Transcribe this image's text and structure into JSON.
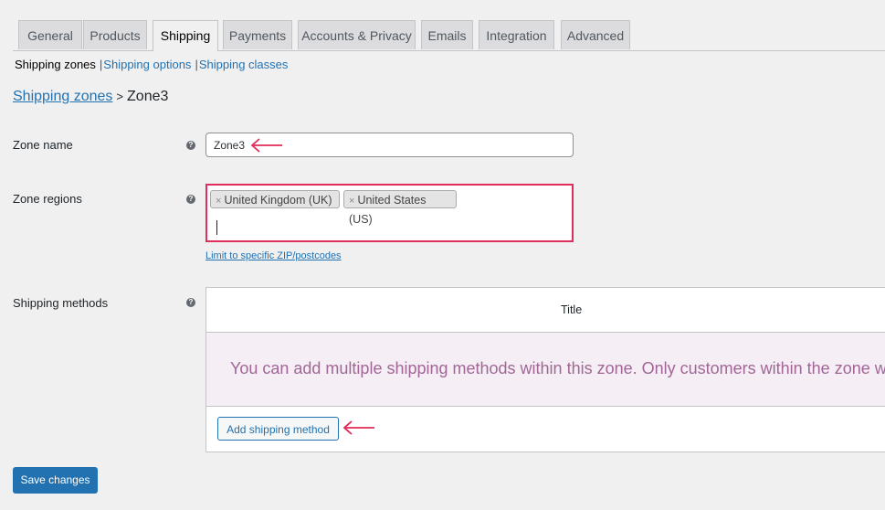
{
  "tabs": [
    {
      "label": "General",
      "active": false
    },
    {
      "label": "Products",
      "active": false
    },
    {
      "label": "Shipping",
      "active": true
    },
    {
      "label": "Payments",
      "active": false
    },
    {
      "label": "Accounts & Privacy",
      "active": false
    },
    {
      "label": "Emails",
      "active": false
    },
    {
      "label": "Integration",
      "active": false
    },
    {
      "label": "Advanced",
      "active": false
    }
  ],
  "subnav": {
    "current": "Shipping zones",
    "separator": "|",
    "links": [
      "Shipping options",
      "Shipping classes"
    ]
  },
  "breadcrumb": {
    "link": "Shipping zones",
    "separator": ">",
    "current": "Zone3"
  },
  "form": {
    "zone_name": {
      "label": "Zone name",
      "help": "?",
      "value": "Zone3"
    },
    "zone_regions": {
      "label": "Zone regions",
      "help": "?",
      "chips": [
        {
          "remove": "×",
          "label": "United Kingdom (UK)"
        },
        {
          "remove": "×",
          "label": "United States (US)"
        }
      ],
      "limit_link": "Limit to specific ZIP/postcodes"
    },
    "shipping_methods": {
      "label": "Shipping methods",
      "help": "?",
      "column_title": "Title",
      "empty_message": "You can add multiple shipping methods within this zone. Only customers within the zone will see them.",
      "add_button": "Add shipping method"
    }
  },
  "save_button": "Save changes",
  "colors": {
    "accent": "#2271b1",
    "highlight": "#e12d5a",
    "empty_text": "#a16696",
    "empty_bg": "#f5eff5"
  }
}
